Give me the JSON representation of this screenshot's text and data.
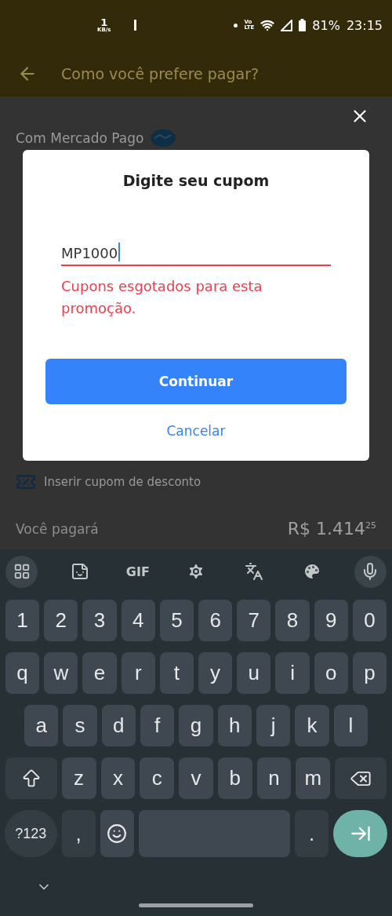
{
  "status_bar": {
    "speed_value": "1",
    "speed_unit": "KB/s",
    "volte_label": "Vo",
    "network_label": "LTE",
    "battery": "81%",
    "time": "23:15"
  },
  "header": {
    "title": "Como você prefere pagar?"
  },
  "background": {
    "section_title": "Com Mercado Pago",
    "coupon_link": "Inserir cupom de desconto",
    "total_label": "Você pagará",
    "total_value": "R$ 1.414$^{25}$"
  },
  "dialog": {
    "title": "Digite seu cupom",
    "input": {
      "value": "MP1000",
      "focused": true
    },
    "error": "Cupons esgotados para esta promoção.",
    "primary_button": "Continuar",
    "secondary_button": "Cancelar"
  },
  "keyboard": {
    "toolbar": [
      {
        "kind": "apps"
      },
      {
        "kind": "sticker"
      },
      {
        "kind": "gif",
        "label": "GIF"
      },
      {
        "kind": "settings"
      },
      {
        "kind": "translate"
      },
      {
        "kind": "theme"
      },
      {
        "kind": "mic"
      }
    ],
    "rows": [
      [
        {
          "kind": "key",
          "label": "1"
        },
        {
          "kind": "key",
          "label": "2"
        },
        {
          "kind": "key",
          "label": "3"
        },
        {
          "kind": "key",
          "label": "4"
        },
        {
          "kind": "key",
          "label": "5"
        },
        {
          "kind": "key",
          "label": "6"
        },
        {
          "kind": "key",
          "label": "7"
        },
        {
          "kind": "key",
          "label": "8"
        },
        {
          "kind": "key",
          "label": "9"
        },
        {
          "kind": "key",
          "label": "0"
        }
      ],
      [
        {
          "kind": "key",
          "label": "q"
        },
        {
          "kind": "key",
          "label": "w"
        },
        {
          "kind": "key",
          "label": "e"
        },
        {
          "kind": "key",
          "label": "r"
        },
        {
          "kind": "key",
          "label": "t"
        },
        {
          "kind": "key",
          "label": "y"
        },
        {
          "kind": "key",
          "label": "u"
        },
        {
          "kind": "key",
          "label": "i"
        },
        {
          "kind": "key",
          "label": "o"
        },
        {
          "kind": "key",
          "label": "p"
        }
      ],
      [
        {
          "kind": "key",
          "label": "a"
        },
        {
          "kind": "key",
          "label": "s"
        },
        {
          "kind": "key",
          "label": "d"
        },
        {
          "kind": "key",
          "label": "f"
        },
        {
          "kind": "key",
          "label": "g"
        },
        {
          "kind": "key",
          "label": "h"
        },
        {
          "kind": "key",
          "label": "j"
        },
        {
          "kind": "key",
          "label": "k"
        },
        {
          "kind": "key",
          "label": "l"
        }
      ],
      [
        {
          "kind": "shift"
        },
        {
          "kind": "key",
          "label": "z"
        },
        {
          "kind": "key",
          "label": "x"
        },
        {
          "kind": "key",
          "label": "c"
        },
        {
          "kind": "key",
          "label": "v"
        },
        {
          "kind": "key",
          "label": "b"
        },
        {
          "kind": "key",
          "label": "n"
        },
        {
          "kind": "key",
          "label": "m"
        },
        {
          "kind": "backspace"
        }
      ],
      [
        {
          "kind": "symbols",
          "label": "?123"
        },
        {
          "kind": "punct",
          "label": ","
        },
        {
          "kind": "emoji"
        },
        {
          "kind": "space"
        },
        {
          "kind": "punct",
          "label": "."
        },
        {
          "kind": "enter"
        }
      ]
    ]
  }
}
